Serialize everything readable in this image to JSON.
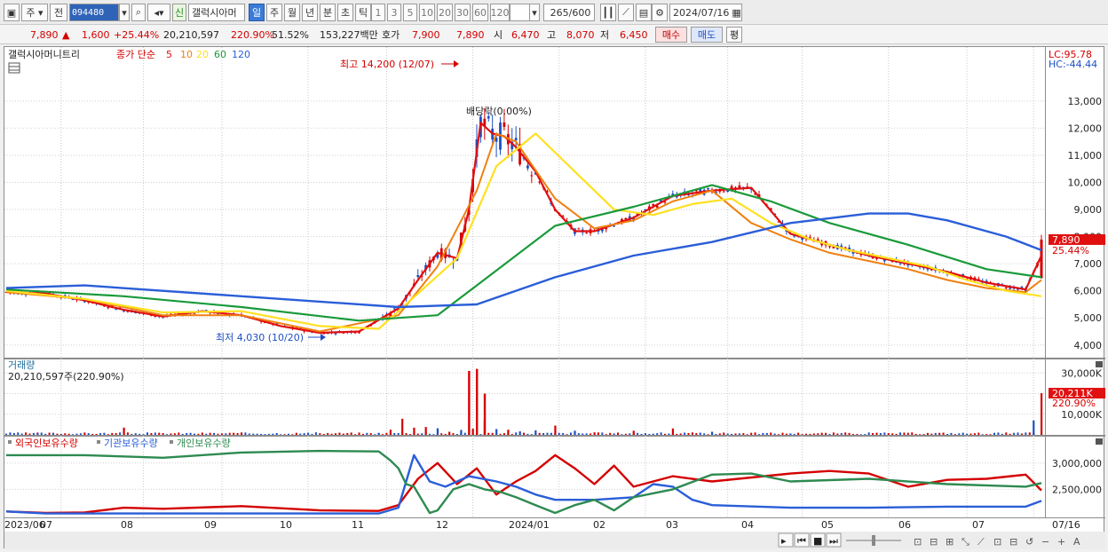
{
  "toolbar": {
    "market_label": "주",
    "prev_label": "전",
    "stock_code": "094480",
    "badge_label": "신",
    "stock_name": "갤럭시아머",
    "period_tabs": [
      "일",
      "주",
      "월",
      "년",
      "분",
      "초",
      "틱"
    ],
    "selected_tab": "일",
    "interval_tabs": [
      "1",
      "3",
      "5",
      "10",
      "20",
      "30",
      "60",
      "120"
    ],
    "count_display": "265/600",
    "date_value": "2024/07/16"
  },
  "quote": {
    "price": "7,890",
    "change": "1,600",
    "change_pct": "+25.44%",
    "volume": "20,210,597",
    "volume_ratio": "220.90%",
    "turnover": "51.52%",
    "amount": "153,227백만",
    "bid_label": "호가",
    "bid_high": "7,900",
    "bid_low": "7,890",
    "open_label": "시",
    "open": "6,470",
    "high_label": "고",
    "high": "8,070",
    "low_label": "저",
    "low": "6,450",
    "buy_label": "매수",
    "sell_label": "매도",
    "eval_label": "평"
  },
  "colors": {
    "up": "#d40000",
    "down": "#1d4fc4",
    "ma5": "#e01010",
    "ma10": "#f08010",
    "ma20": "#ffe020",
    "ma60": "#1a9a3a",
    "ma120": "#2a5ed8"
  },
  "chart_data": [
    {
      "type": "line",
      "panel": "price",
      "title": "갤럭시아머니트리",
      "legend": {
        "prefix": "종가 단순",
        "periods": [
          "5",
          "10",
          "20",
          "60",
          "120"
        ]
      },
      "ylim": [
        3600,
        14600
      ],
      "yticks": [
        "13,000",
        "12,000",
        "11,000",
        "10,000",
        "9,000",
        "8,000",
        "7,000",
        "6,000",
        "5,000",
        "4,000"
      ],
      "ytick_values": [
        13000,
        12000,
        11000,
        10000,
        9000,
        8000,
        7000,
        6000,
        5000,
        4000
      ],
      "x_labels": [
        "2023/06",
        "07",
        "08",
        "09",
        "10",
        "11",
        "12",
        "2024/01",
        "02",
        "03",
        "04",
        "05",
        "06",
        "07",
        "07/16"
      ],
      "annotations": {
        "high": "최고 14,200 (12/07)",
        "low": "최저 4,030 (10/20)",
        "gap": "배당락(0.00%)",
        "lc": "LC:95.78",
        "hc": "HC:-44.44",
        "last_price": "7,890",
        "last_pct": "25.44%"
      },
      "series": [
        {
          "name": "5",
          "x": [
            0,
            10,
            20,
            30,
            40,
            50,
            60,
            70,
            80,
            90,
            100,
            105,
            110,
            115,
            118,
            121,
            124,
            127,
            130,
            135,
            140,
            145,
            150,
            160,
            170,
            180,
            190,
            200,
            210,
            220,
            230,
            240,
            250,
            260,
            264
          ],
          "values": [
            5950,
            5900,
            5650,
            5300,
            5050,
            5250,
            5100,
            4700,
            4450,
            4500,
            5350,
            6400,
            7400,
            7200,
            9000,
            12200,
            11800,
            11700,
            11300,
            10400,
            9000,
            8200,
            8200,
            8700,
            9500,
            9700,
            9800,
            8100,
            7700,
            7300,
            7000,
            6700,
            6300,
            6050,
            7300
          ]
        },
        {
          "name": "10",
          "x": [
            0,
            20,
            40,
            60,
            80,
            100,
            110,
            120,
            125,
            130,
            140,
            150,
            160,
            170,
            180,
            190,
            200,
            210,
            220,
            230,
            240,
            250,
            260,
            264
          ],
          "values": [
            5950,
            5700,
            5100,
            5100,
            4500,
            5100,
            6900,
            9700,
            11800,
            11500,
            9400,
            8300,
            8600,
            9300,
            9700,
            8500,
            7900,
            7400,
            7100,
            6800,
            6400,
            6100,
            5950,
            6400
          ]
        },
        {
          "name": "20",
          "x": [
            0,
            20,
            40,
            60,
            80,
            95,
            105,
            115,
            125,
            135,
            145,
            155,
            165,
            175,
            185,
            195,
            205,
            215,
            225,
            235,
            245,
            255,
            264
          ],
          "values": [
            6000,
            5700,
            5200,
            5250,
            4700,
            4600,
            5900,
            7200,
            10600,
            11800,
            10400,
            9000,
            8800,
            9200,
            9400,
            8500,
            7900,
            7500,
            7200,
            6900,
            6400,
            6000,
            5800
          ]
        },
        {
          "name": "60",
          "x": [
            0,
            30,
            60,
            90,
            110,
            120,
            140,
            160,
            180,
            195,
            210,
            230,
            250,
            264
          ],
          "values": [
            6050,
            5800,
            5400,
            4900,
            5100,
            6200,
            8400,
            9100,
            9900,
            9300,
            8500,
            7700,
            6800,
            6500
          ]
        },
        {
          "name": "120",
          "x": [
            0,
            20,
            60,
            100,
            120,
            140,
            160,
            180,
            200,
            220,
            230,
            240,
            255,
            264
          ],
          "values": [
            6100,
            6200,
            5800,
            5400,
            5500,
            6500,
            7300,
            7800,
            8500,
            8850,
            8850,
            8600,
            8000,
            7500
          ]
        }
      ]
    },
    {
      "type": "bar",
      "panel": "volume",
      "title": "거래량",
      "readout": "20,210,597주(220.90%)",
      "yticks": [
        "30,000K",
        "20,000K",
        "10,000K"
      ],
      "ytick_values": [
        30000,
        20000,
        10000
      ],
      "ylim": [
        0,
        34000
      ],
      "last_value": "20,211K",
      "last_pct": "220.90%",
      "x": [
        8,
        14,
        30,
        60,
        95,
        98,
        101,
        104,
        107,
        110,
        113,
        116,
        119,
        122,
        125,
        128,
        131,
        135,
        140,
        145,
        150,
        160,
        170,
        180,
        200,
        240,
        262,
        264
      ],
      "values": [
        800,
        300,
        3500,
        700,
        900,
        2500,
        7800,
        3500,
        3800,
        3200,
        1500,
        2400,
        3000,
        6800,
        2800,
        2500,
        1700,
        2200,
        4500,
        2000,
        1200,
        2000,
        3100,
        1500,
        600,
        400,
        7000,
        20211
      ],
      "direction": [
        "d",
        "d",
        "u",
        "u",
        "d",
        "u",
        "u",
        "u",
        "u",
        "d",
        "u",
        "d",
        "u",
        "u",
        "d",
        "u",
        "d",
        "d",
        "u",
        "d",
        "u",
        "u",
        "u",
        "d",
        "d",
        "d",
        "d",
        "u"
      ],
      "spikes": {
        "x": [
          118,
          120,
          122
        ],
        "values": [
          31000,
          32000,
          20000
        ]
      }
    },
    {
      "type": "line",
      "panel": "holdings",
      "legend": [
        "외국인보유수량",
        "기관보유수량",
        "개인보유수량"
      ],
      "yticks": [
        "3,000,000",
        "2,500,000"
      ],
      "ytick_values": [
        3000000,
        2500000
      ],
      "ylim": [
        2000000,
        3300000
      ],
      "series": [
        {
          "name": "외국인보유수량",
          "x": [
            0,
            10,
            20,
            30,
            40,
            60,
            80,
            95,
            100,
            105,
            110,
            115,
            120,
            125,
            130,
            135,
            140,
            145,
            150,
            155,
            160,
            170,
            180,
            200,
            210,
            220,
            230,
            240,
            250,
            260,
            264
          ],
          "values": [
            2080000,
            2050000,
            2060000,
            2150000,
            2130000,
            2180000,
            2100000,
            2090000,
            2200000,
            2700000,
            3000000,
            2600000,
            2900000,
            2400000,
            2650000,
            2850000,
            3150000,
            2900000,
            2600000,
            2950000,
            2550000,
            2750000,
            2650000,
            2800000,
            2850000,
            2800000,
            2550000,
            2680000,
            2700000,
            2780000,
            2480000
          ]
        },
        {
          "name": "기관보유수량",
          "x": [
            0,
            10,
            20,
            40,
            60,
            80,
            95,
            100,
            104,
            108,
            112,
            118,
            125,
            130,
            135,
            140,
            150,
            160,
            165,
            170,
            175,
            180,
            200,
            220,
            240,
            260,
            264
          ],
          "values": [
            2080000,
            2040000,
            2040000,
            2040000,
            2040000,
            2040000,
            2040000,
            2150000,
            3150000,
            2650000,
            2550000,
            2750000,
            2650000,
            2550000,
            2400000,
            2300000,
            2300000,
            2350000,
            2600000,
            2550000,
            2300000,
            2200000,
            2150000,
            2150000,
            2170000,
            2170000,
            2280000
          ]
        },
        {
          "name": "개인보유수량",
          "x": [
            0,
            20,
            40,
            60,
            80,
            95,
            98,
            100,
            102,
            104,
            106,
            108,
            110,
            112,
            114,
            118,
            122,
            126,
            130,
            135,
            140,
            145,
            150,
            155,
            160,
            170,
            180,
            190,
            200,
            220,
            240,
            260,
            264
          ],
          "values": [
            3150000,
            3150000,
            3100000,
            3200000,
            3230000,
            3220000,
            3050000,
            2900000,
            2600000,
            2550000,
            2300000,
            2050000,
            2100000,
            2300000,
            2500000,
            2600000,
            2500000,
            2450000,
            2350000,
            2200000,
            2050000,
            2200000,
            2300000,
            2100000,
            2350000,
            2500000,
            2780000,
            2800000,
            2650000,
            2700000,
            2600000,
            2550000,
            2620000
          ]
        }
      ]
    }
  ],
  "bottom_controls": [
    "scroll-right",
    "rewind",
    "stop",
    "forward"
  ]
}
